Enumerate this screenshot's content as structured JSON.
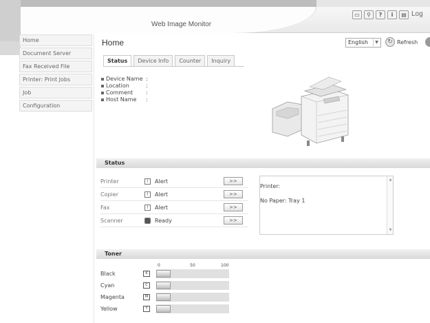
{
  "header": {
    "app_title": "Web Image Monitor",
    "logout_label": "Log",
    "icons": [
      "display-icon",
      "search-icon",
      "help-icon",
      "info-icon",
      "logout-icon"
    ]
  },
  "sidebar": {
    "items": [
      {
        "label": "Home"
      },
      {
        "label": "Document Server"
      },
      {
        "label": "Fax Received File"
      },
      {
        "label": "Printer: Print Jobs"
      },
      {
        "label": "Job"
      },
      {
        "label": "Configuration"
      }
    ]
  },
  "main": {
    "title": "Home",
    "language": "English",
    "refresh_label": "Refresh",
    "tabs": [
      {
        "label": "Status",
        "active": true
      },
      {
        "label": "Device Info",
        "active": false
      },
      {
        "label": "Counter",
        "active": false
      },
      {
        "label": "Inquiry",
        "active": false
      }
    ],
    "device_info": [
      {
        "label": "Device Name",
        "sep": ":"
      },
      {
        "label": "Location",
        "sep": ":"
      },
      {
        "label": "Comment",
        "sep": ":"
      },
      {
        "label": "Host Name",
        "sep": ":"
      }
    ]
  },
  "status": {
    "section_title": "Status",
    "rows": [
      {
        "name": "Printer",
        "value": "Alert",
        "icon": "alert-icon"
      },
      {
        "name": "Copier",
        "value": "Alert",
        "icon": "alert-icon"
      },
      {
        "name": "Fax",
        "value": "Alert",
        "icon": "alert-icon"
      },
      {
        "name": "Scanner",
        "value": "Ready",
        "icon": "ready-icon"
      }
    ],
    "detail_button_label": ">>",
    "message": {
      "line1": "Printer:",
      "line2": "No Paper: Tray 1"
    }
  },
  "toner": {
    "section_title": "Toner",
    "scale": [
      "0",
      "50",
      "100"
    ],
    "rows": [
      {
        "name": "Black",
        "level": 20
      },
      {
        "name": "Cyan",
        "level": 20
      },
      {
        "name": "Magenta",
        "level": 20
      },
      {
        "name": "Yellow",
        "level": 20
      }
    ]
  }
}
